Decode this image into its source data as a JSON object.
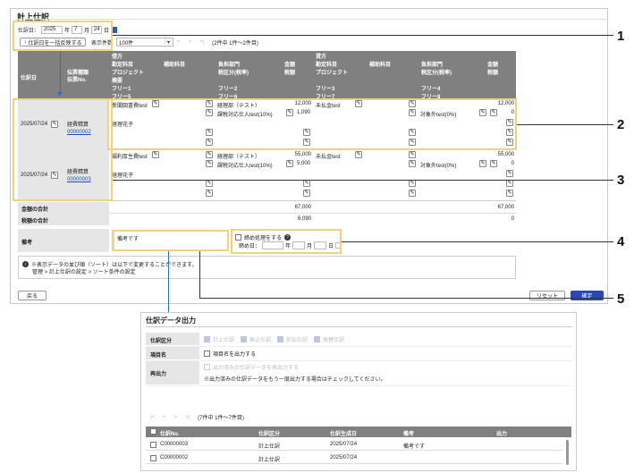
{
  "title": "計上仕訳",
  "date": {
    "label": "仕訳日：",
    "year": "2025",
    "year_suffix": "年",
    "month": "7",
    "month_suffix": "月",
    "day": "24",
    "day_suffix": "日"
  },
  "bulk_button": "仕訳日を一括反映する",
  "display_count": {
    "label": "表示件数",
    "value": "100件"
  },
  "pager": {
    "first": "|<",
    "prev": "<",
    "next": ">",
    "last": ">|",
    "info": "(2件中 1件〜2件目)"
  },
  "headers": {
    "debit": "借方",
    "credit": "貸方",
    "date": "仕訳日",
    "voucher_line1": "伝票種類",
    "voucher_line2": "伝票No.",
    "account": "勘定科目",
    "sub_account": "補助科目",
    "dept": "負担部門",
    "amount": "金額",
    "project": "プロジェクト",
    "tax": "税区分(税率)",
    "tax_amount": "税額",
    "summary": "摘要",
    "free1": "フリー1",
    "free2": "フリー2",
    "free3": "フリー3",
    "free4": "フリー4",
    "free5": "フリー5",
    "free6": "フリー6",
    "free7": "フリー7",
    "free8": "フリー8"
  },
  "rows": [
    {
      "date": "2025/07/24",
      "voucher_type": "経費精算",
      "voucher_no": "00000002",
      "debit_account": "新聞図書費test",
      "debit_dept": "経理部（テスト）",
      "debit_amount": "12,000",
      "debit_tax": "課税対応仕入test(10%)",
      "debit_tax_amount": "1,090",
      "credit_account": "未払金test",
      "credit_amount": "12,000",
      "credit_tax": "対象外test(0%)",
      "credit_tax_amount": "0",
      "summary": "経理花子"
    },
    {
      "date": "2025/07/24",
      "voucher_type": "経費精算",
      "voucher_no": "00000003",
      "debit_account": "福利厚生費test",
      "debit_dept": "経理部（テスト）",
      "debit_amount": "55,000",
      "debit_tax": "課税対応仕入test(10%)",
      "debit_tax_amount": "5,000",
      "credit_account": "未払金test",
      "credit_amount": "55,000",
      "credit_tax": "対象外test(0%)",
      "credit_tax_amount": "0",
      "summary": "経理花子"
    }
  ],
  "totals": {
    "amount_label": "金額の合計",
    "amount_debit": "67,000",
    "amount_credit": "67,000",
    "tax_label": "税額の合計",
    "tax_debit": "6,090",
    "tax_credit": "0"
  },
  "remarks": {
    "label": "備考",
    "value": "備考です"
  },
  "reverse": {
    "checkbox_label": "締め処理をする",
    "date_label": "締め日：",
    "year_suffix": "年",
    "month_suffix": "月",
    "day_suffix": "日"
  },
  "info": {
    "line1": "※表示データの並び順（ソート）は以下で変更することができます。",
    "line2": "管理 > 計上仕訳の設定 > ソート条件の設定"
  },
  "buttons": {
    "back": "戻る",
    "reset": "リセット",
    "confirm": "確定"
  },
  "annotations": [
    "1",
    "2",
    "3",
    "4",
    "5"
  ],
  "output": {
    "title": "仕訳データ出力",
    "kubun_label": "仕訳区分",
    "kubun_options": [
      "計上仕訳",
      "振込仕訳",
      "前払仕訳",
      "振替仕訳"
    ],
    "item_label": "項目名",
    "item_option": "項目名を出力する",
    "reout_label": "再出力",
    "reout_option": "出力済みの仕訳データを再出力する",
    "reout_note": "※出力済みの仕訳データをもう一度出力する場合はチェックしてください。",
    "pager_info": "(7件中 1件〜7件目)",
    "columns": [
      "仕訳No.",
      "仕訳区分",
      "仕訳生成日",
      "備考",
      "出力"
    ],
    "rows": [
      {
        "no": "C00000003",
        "kubun": "計上仕訳",
        "date": "2025/07/24",
        "remark": "備考です"
      },
      {
        "no": "C00000002",
        "kubun": "計上仕訳",
        "date": "2025/07/24",
        "remark": ""
      }
    ]
  }
}
